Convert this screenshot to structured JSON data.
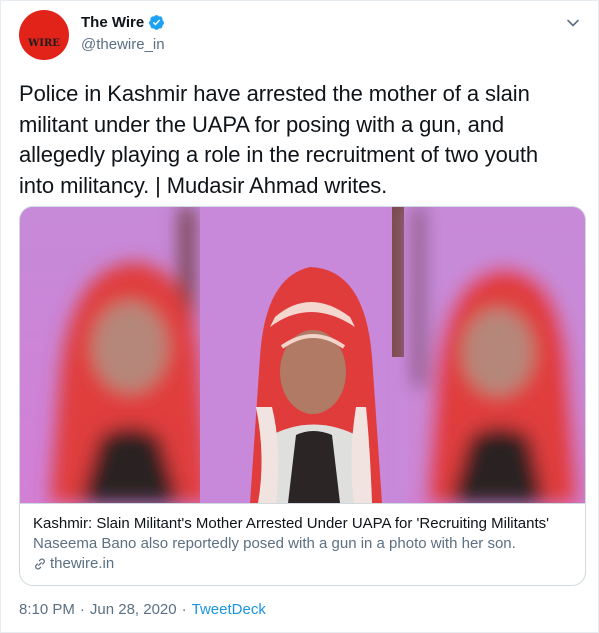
{
  "author": {
    "name": "The Wire",
    "handle": "@thewire_in",
    "avatar_text": "WIRE",
    "verified": true
  },
  "icons": {
    "verified": "verified-badge-icon",
    "menu": "chevron-down-icon",
    "link": "link-icon"
  },
  "tweet": {
    "text": "Police in Kashmir have arrested the mother of a slain militant under the UAPA for posing with a gun, and allegedly playing a role in the recruitment of two youth into militancy. | Mudasir Ahmad writes."
  },
  "card": {
    "title": "Kashmir: Slain Militant's Mother Arrested Under UAPA for 'Recruiting Militants'",
    "description": "Naseema Bano also reportedly posed with a gun in a photo with her son.",
    "domain": "thewire.in"
  },
  "meta": {
    "time": "8:10 PM",
    "date": "Jun 28, 2020",
    "separator": "·",
    "source": "TweetDeck"
  },
  "colors": {
    "accent": "#1b95e0",
    "verified": "#1da1f2",
    "muted_text": "#5b7083",
    "avatar_bg": "#e2231a",
    "photo_background": "#c980d6",
    "scarf": "#e03c3c"
  }
}
